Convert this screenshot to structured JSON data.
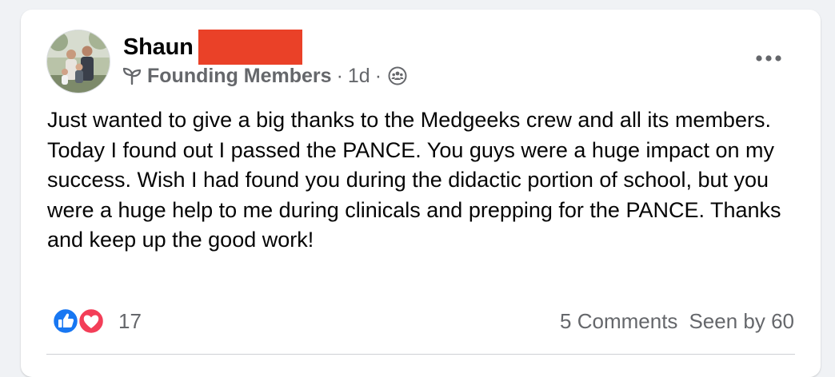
{
  "post": {
    "author": {
      "name": "Shaun",
      "avatar_icon": "family-photo-avatar"
    },
    "group": {
      "badge_icon": "sprout-icon",
      "label": "Founding Members"
    },
    "separator": "·",
    "timestamp": "1d",
    "audience_icon": "group-members-icon",
    "more_icon": "more-options-icon",
    "body": "Just wanted to give a big thanks to the Medgeeks crew and all its members. Today I found out I passed the PANCE. You guys were a huge impact on my success. Wish I had found you during the didactic portion of school, but you were a huge help to me during clinicals and prepping for the PANCE. Thanks and keep up the good work!",
    "reactions": {
      "icons": [
        "like-icon",
        "love-icon"
      ],
      "count": "17"
    },
    "comments_label": "5 Comments",
    "seen_label": "Seen by 60"
  },
  "colors": {
    "redaction": "#ea4128",
    "like_blue": "#1877f2",
    "love_red": "#f33e58",
    "secondary_text": "#65676b"
  }
}
